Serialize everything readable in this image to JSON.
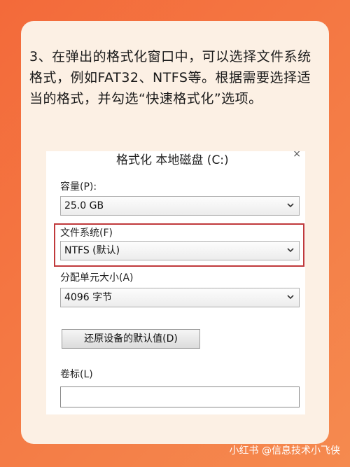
{
  "instruction": "3、在弹出的格式化窗口中，可以选择文件系统格式，例如FAT32、NTFS等。根据需要选择适当的格式，并勾选“快速格式化”选项。",
  "dialog": {
    "title": "格式化 本地磁盘 (C:)",
    "close": "×",
    "capacity_label": "容量(P):",
    "capacity_value": "25.0 GB",
    "filesystem_label": "文件系统(F)",
    "filesystem_value": "NTFS (默认)",
    "allocation_label": "分配单元大小(A)",
    "allocation_value": "4096 字节",
    "restore_button": "还原设备的默认值(D)",
    "volume_label": "卷标(L)",
    "volume_value": ""
  },
  "highlight_color": "#c0393b",
  "watermark": "小红书 @信息技术小飞侠"
}
